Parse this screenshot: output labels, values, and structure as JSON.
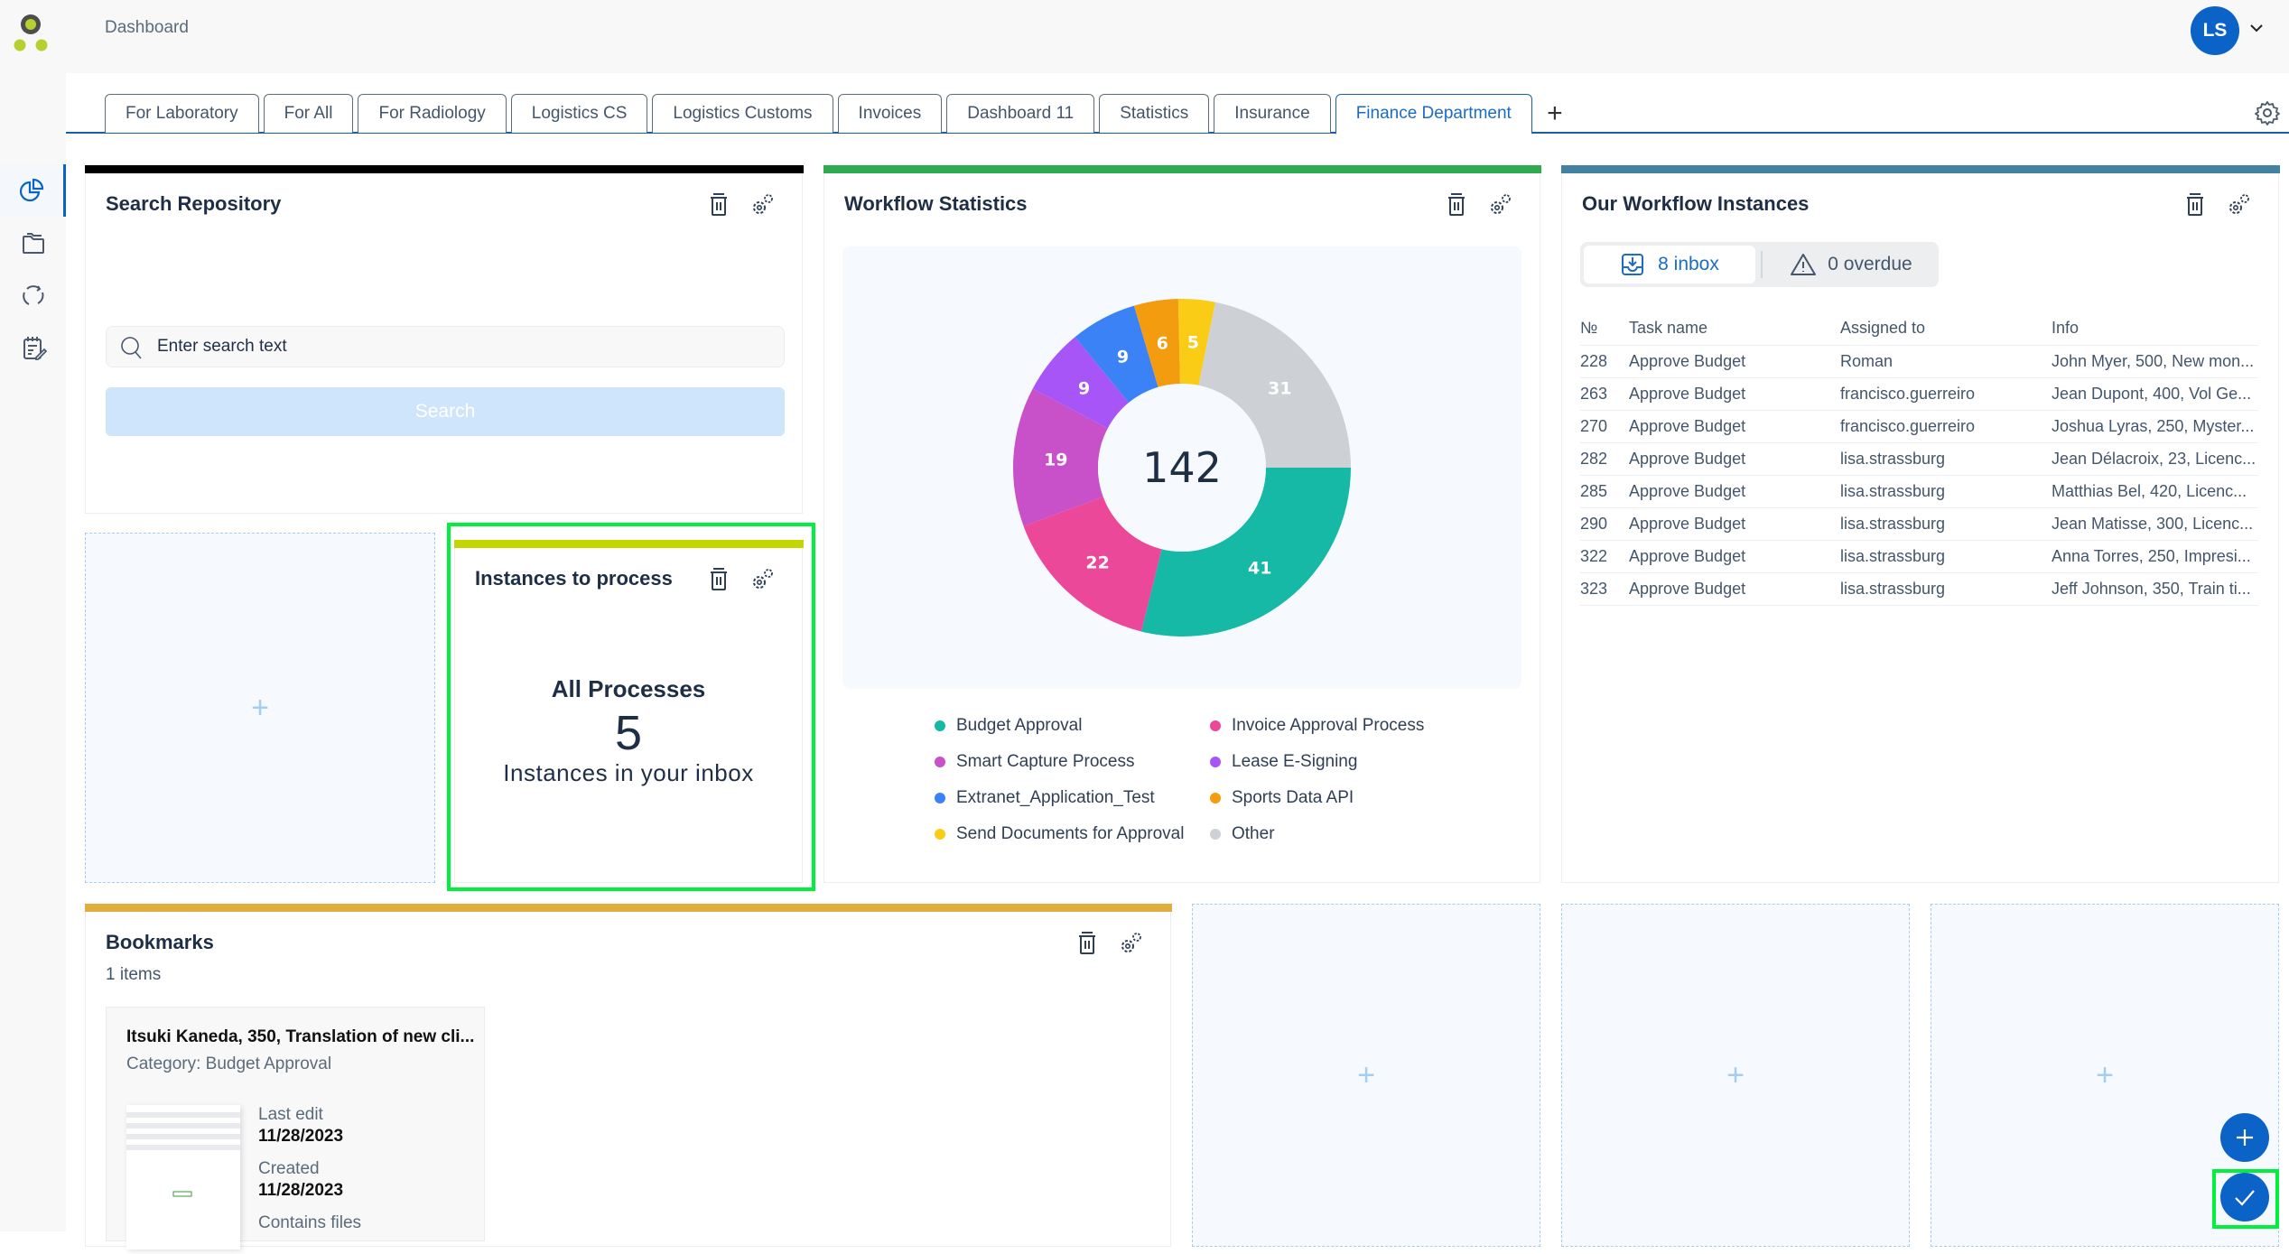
{
  "header": {
    "breadcrumb": "Dashboard",
    "user_initials": "LS"
  },
  "sidebar": {
    "items": [
      {
        "name": "dashboard",
        "icon": "pie-chart-icon",
        "active": true
      },
      {
        "name": "repository",
        "icon": "folder-icon",
        "active": false
      },
      {
        "name": "workflows",
        "icon": "refresh-cycle-icon",
        "active": false
      },
      {
        "name": "tasks",
        "icon": "notepad-edit-icon",
        "active": false
      }
    ]
  },
  "tabs": {
    "items": [
      {
        "label": "For Laboratory",
        "active": false
      },
      {
        "label": "For All",
        "active": false
      },
      {
        "label": "For Radiology",
        "active": false
      },
      {
        "label": "Logistics CS",
        "active": false
      },
      {
        "label": "Logistics Customs",
        "active": false
      },
      {
        "label": "Invoices",
        "active": false
      },
      {
        "label": "Dashboard 11",
        "active": false
      },
      {
        "label": "Statistics",
        "active": false
      },
      {
        "label": "Insurance",
        "active": false
      },
      {
        "label": "Finance Department",
        "active": true
      }
    ],
    "add_label": "+"
  },
  "search_panel": {
    "title": "Search Repository",
    "bar_color": "#000000",
    "placeholder": "Enter search text",
    "value": "",
    "button_label": "Search"
  },
  "workflow_stats": {
    "title": "Workflow Statistics",
    "bar_color": "#2eaa50",
    "total": "142"
  },
  "chart_data": {
    "type": "pie",
    "subtype": "donut",
    "title": "Workflow Statistics",
    "center_label": "142",
    "start_angle": "3 o'clock, clockwise",
    "legend_position": "bottom",
    "slices": [
      {
        "label": "Budget Approval",
        "value": 41,
        "color": "#16b8a6"
      },
      {
        "label": "Invoice Approval Process",
        "value": 22,
        "color": "#ec4899"
      },
      {
        "label": "Smart Capture Process",
        "value": 19,
        "color": "#c850c8"
      },
      {
        "label": "Lease E-Signing",
        "value": 9,
        "color": "#a855f7"
      },
      {
        "label": "Extranet_Application_Test",
        "value": 9,
        "color": "#3b82f6"
      },
      {
        "label": "Sports Data API",
        "value": 6,
        "color": "#f39c0f"
      },
      {
        "label": "Send Documents for Approval",
        "value": 5,
        "color": "#facc15"
      },
      {
        "label": "Other",
        "value": 31,
        "color": "#cdd1d5"
      }
    ],
    "legend": [
      "Budget Approval",
      "Invoice Approval Process",
      "Smart Capture Process",
      "Lease E-Signing",
      "Extranet_Application_Test",
      "Sports Data API",
      "Send Documents for Approval",
      "Other"
    ]
  },
  "workflow_instances": {
    "title": "Our Workflow Instances",
    "bar_color": "#4282a0",
    "inbox_label": "8 inbox",
    "overdue_label": "0 overdue",
    "columns": [
      "№",
      "Task name",
      "Assigned to",
      "Info"
    ],
    "rows": [
      [
        "228",
        "Approve Budget",
        "Roman",
        "John Myer, 500, New mon..."
      ],
      [
        "263",
        "Approve Budget",
        "francisco.guerreiro",
        "Jean Dupont, 400, Vol Ge..."
      ],
      [
        "270",
        "Approve Budget",
        "francisco.guerreiro",
        "Joshua Lyras, 250, Myster..."
      ],
      [
        "282",
        "Approve Budget",
        "lisa.strassburg",
        "Jean Délacroix, 23, Licenc..."
      ],
      [
        "285",
        "Approve Budget",
        "lisa.strassburg",
        "Matthias Bel, 420, Licenc..."
      ],
      [
        "290",
        "Approve Budget",
        "lisa.strassburg",
        "Jean Matisse, 300, Licenc..."
      ],
      [
        "322",
        "Approve Budget",
        "lisa.strassburg",
        "Anna Torres, 250, Impresi..."
      ],
      [
        "323",
        "Approve Budget",
        "lisa.strassburg",
        "Jeff Johnson, 350, Train ti..."
      ]
    ]
  },
  "instances_panel": {
    "title": "Instances to process",
    "bar_color": "#c2d600",
    "heading": "All Processes",
    "count": "5",
    "subtitle": "Instances in your inbox"
  },
  "bookmarks": {
    "title": "Bookmarks",
    "bar_color": "#e0ae3e",
    "count_label": "1 items",
    "items": [
      {
        "title": "Itsuki Kaneda, 350, Translation of new cli...",
        "category": "Category: Budget Approval",
        "last_edit_label": "Last edit",
        "last_edit": "11/28/2023",
        "created_label": "Created",
        "created": "11/28/2023",
        "files_label": "Contains files"
      }
    ]
  },
  "empty_tile": {
    "label": "+"
  },
  "fabs": {
    "add": "+",
    "confirm": "✓"
  },
  "colors": {
    "accent": "#0b63c8",
    "focus": "#00f03c"
  }
}
